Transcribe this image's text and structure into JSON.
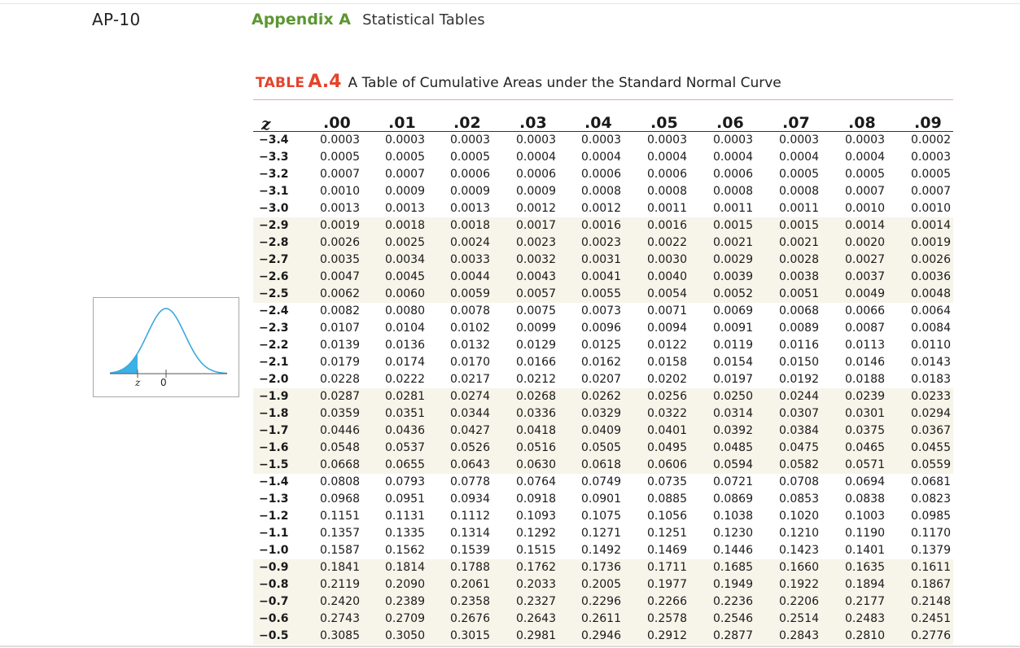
{
  "page_number": "AP-10",
  "header": {
    "appendix_label": "Appendix A",
    "appendix_title": "Statistical Tables"
  },
  "table_title": {
    "prefix": "TABLE",
    "number": "A.4",
    "caption": "A Table of Cumulative Areas under the Standard Normal Curve"
  },
  "figure": {
    "z_label": "z",
    "zero_label": "0",
    "shade_color": "#3bb2e6"
  },
  "table": {
    "z_header": "z",
    "columns": [
      ".00",
      ".01",
      ".02",
      ".03",
      ".04",
      ".05",
      ".06",
      ".07",
      ".08",
      ".09"
    ],
    "rows": [
      {
        "z": "−3.4",
        "values": [
          "0.0003",
          "0.0003",
          "0.0003",
          "0.0003",
          "0.0003",
          "0.0003",
          "0.0003",
          "0.0003",
          "0.0003",
          "0.0002"
        ]
      },
      {
        "z": "−3.3",
        "values": [
          "0.0005",
          "0.0005",
          "0.0005",
          "0.0004",
          "0.0004",
          "0.0004",
          "0.0004",
          "0.0004",
          "0.0004",
          "0.0003"
        ]
      },
      {
        "z": "−3.2",
        "values": [
          "0.0007",
          "0.0007",
          "0.0006",
          "0.0006",
          "0.0006",
          "0.0006",
          "0.0006",
          "0.0005",
          "0.0005",
          "0.0005"
        ]
      },
      {
        "z": "−3.1",
        "values": [
          "0.0010",
          "0.0009",
          "0.0009",
          "0.0009",
          "0.0008",
          "0.0008",
          "0.0008",
          "0.0008",
          "0.0007",
          "0.0007"
        ]
      },
      {
        "z": "−3.0",
        "values": [
          "0.0013",
          "0.0013",
          "0.0013",
          "0.0012",
          "0.0012",
          "0.0011",
          "0.0011",
          "0.0011",
          "0.0010",
          "0.0010"
        ]
      },
      {
        "z": "−2.9",
        "values": [
          "0.0019",
          "0.0018",
          "0.0018",
          "0.0017",
          "0.0016",
          "0.0016",
          "0.0015",
          "0.0015",
          "0.0014",
          "0.0014"
        ]
      },
      {
        "z": "−2.8",
        "values": [
          "0.0026",
          "0.0025",
          "0.0024",
          "0.0023",
          "0.0023",
          "0.0022",
          "0.0021",
          "0.0021",
          "0.0020",
          "0.0019"
        ]
      },
      {
        "z": "−2.7",
        "values": [
          "0.0035",
          "0.0034",
          "0.0033",
          "0.0032",
          "0.0031",
          "0.0030",
          "0.0029",
          "0.0028",
          "0.0027",
          "0.0026"
        ]
      },
      {
        "z": "−2.6",
        "values": [
          "0.0047",
          "0.0045",
          "0.0044",
          "0.0043",
          "0.0041",
          "0.0040",
          "0.0039",
          "0.0038",
          "0.0037",
          "0.0036"
        ]
      },
      {
        "z": "−2.5",
        "values": [
          "0.0062",
          "0.0060",
          "0.0059",
          "0.0057",
          "0.0055",
          "0.0054",
          "0.0052",
          "0.0051",
          "0.0049",
          "0.0048"
        ]
      },
      {
        "z": "−2.4",
        "values": [
          "0.0082",
          "0.0080",
          "0.0078",
          "0.0075",
          "0.0073",
          "0.0071",
          "0.0069",
          "0.0068",
          "0.0066",
          "0.0064"
        ]
      },
      {
        "z": "−2.3",
        "values": [
          "0.0107",
          "0.0104",
          "0.0102",
          "0.0099",
          "0.0096",
          "0.0094",
          "0.0091",
          "0.0089",
          "0.0087",
          "0.0084"
        ]
      },
      {
        "z": "−2.2",
        "values": [
          "0.0139",
          "0.0136",
          "0.0132",
          "0.0129",
          "0.0125",
          "0.0122",
          "0.0119",
          "0.0116",
          "0.0113",
          "0.0110"
        ]
      },
      {
        "z": "−2.1",
        "values": [
          "0.0179",
          "0.0174",
          "0.0170",
          "0.0166",
          "0.0162",
          "0.0158",
          "0.0154",
          "0.0150",
          "0.0146",
          "0.0143"
        ]
      },
      {
        "z": "−2.0",
        "values": [
          "0.0228",
          "0.0222",
          "0.0217",
          "0.0212",
          "0.0207",
          "0.0202",
          "0.0197",
          "0.0192",
          "0.0188",
          "0.0183"
        ]
      },
      {
        "z": "−1.9",
        "values": [
          "0.0287",
          "0.0281",
          "0.0274",
          "0.0268",
          "0.0262",
          "0.0256",
          "0.0250",
          "0.0244",
          "0.0239",
          "0.0233"
        ]
      },
      {
        "z": "−1.8",
        "values": [
          "0.0359",
          "0.0351",
          "0.0344",
          "0.0336",
          "0.0329",
          "0.0322",
          "0.0314",
          "0.0307",
          "0.0301",
          "0.0294"
        ]
      },
      {
        "z": "−1.7",
        "values": [
          "0.0446",
          "0.0436",
          "0.0427",
          "0.0418",
          "0.0409",
          "0.0401",
          "0.0392",
          "0.0384",
          "0.0375",
          "0.0367"
        ]
      },
      {
        "z": "−1.6",
        "values": [
          "0.0548",
          "0.0537",
          "0.0526",
          "0.0516",
          "0.0505",
          "0.0495",
          "0.0485",
          "0.0475",
          "0.0465",
          "0.0455"
        ]
      },
      {
        "z": "−1.5",
        "values": [
          "0.0668",
          "0.0655",
          "0.0643",
          "0.0630",
          "0.0618",
          "0.0606",
          "0.0594",
          "0.0582",
          "0.0571",
          "0.0559"
        ]
      },
      {
        "z": "−1.4",
        "values": [
          "0.0808",
          "0.0793",
          "0.0778",
          "0.0764",
          "0.0749",
          "0.0735",
          "0.0721",
          "0.0708",
          "0.0694",
          "0.0681"
        ]
      },
      {
        "z": "−1.3",
        "values": [
          "0.0968",
          "0.0951",
          "0.0934",
          "0.0918",
          "0.0901",
          "0.0885",
          "0.0869",
          "0.0853",
          "0.0838",
          "0.0823"
        ]
      },
      {
        "z": "−1.2",
        "values": [
          "0.1151",
          "0.1131",
          "0.1112",
          "0.1093",
          "0.1075",
          "0.1056",
          "0.1038",
          "0.1020",
          "0.1003",
          "0.0985"
        ]
      },
      {
        "z": "−1.1",
        "values": [
          "0.1357",
          "0.1335",
          "0.1314",
          "0.1292",
          "0.1271",
          "0.1251",
          "0.1230",
          "0.1210",
          "0.1190",
          "0.1170"
        ]
      },
      {
        "z": "−1.0",
        "values": [
          "0.1587",
          "0.1562",
          "0.1539",
          "0.1515",
          "0.1492",
          "0.1469",
          "0.1446",
          "0.1423",
          "0.1401",
          "0.1379"
        ]
      },
      {
        "z": "−0.9",
        "values": [
          "0.1841",
          "0.1814",
          "0.1788",
          "0.1762",
          "0.1736",
          "0.1711",
          "0.1685",
          "0.1660",
          "0.1635",
          "0.1611"
        ]
      },
      {
        "z": "−0.8",
        "values": [
          "0.2119",
          "0.2090",
          "0.2061",
          "0.2033",
          "0.2005",
          "0.1977",
          "0.1949",
          "0.1922",
          "0.1894",
          "0.1867"
        ]
      },
      {
        "z": "−0.7",
        "values": [
          "0.2420",
          "0.2389",
          "0.2358",
          "0.2327",
          "0.2296",
          "0.2266",
          "0.2236",
          "0.2206",
          "0.2177",
          "0.2148"
        ]
      },
      {
        "z": "−0.6",
        "values": [
          "0.2743",
          "0.2709",
          "0.2676",
          "0.2643",
          "0.2611",
          "0.2578",
          "0.2546",
          "0.2514",
          "0.2483",
          "0.2451"
        ]
      },
      {
        "z": "−0.5",
        "values": [
          "0.3085",
          "0.3050",
          "0.3015",
          "0.2981",
          "0.2946",
          "0.2912",
          "0.2877",
          "0.2843",
          "0.2810",
          "0.2776"
        ]
      }
    ]
  }
}
